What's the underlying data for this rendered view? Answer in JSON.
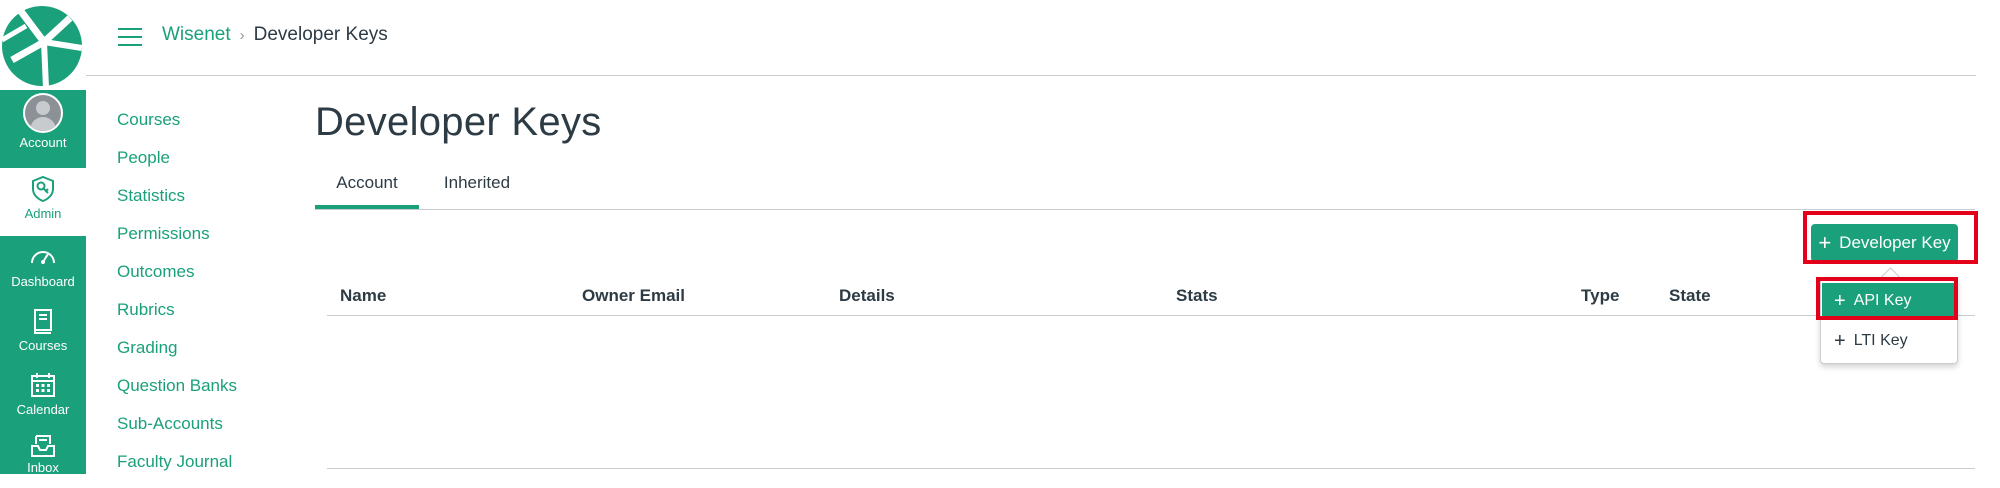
{
  "global_nav": {
    "account_label": "Account",
    "admin_label": "Admin",
    "dashboard_label": "Dashboard",
    "courses_label": "Courses",
    "calendar_label": "Calendar",
    "inbox_label": "Inbox"
  },
  "header": {
    "breadcrumb_root": "Wisenet",
    "breadcrumb_separator": "›",
    "breadcrumb_current": "Developer Keys"
  },
  "course_nav": {
    "items": [
      {
        "label": "Courses"
      },
      {
        "label": "People"
      },
      {
        "label": "Statistics"
      },
      {
        "label": "Permissions"
      },
      {
        "label": "Outcomes"
      },
      {
        "label": "Rubrics"
      },
      {
        "label": "Grading"
      },
      {
        "label": "Question Banks"
      },
      {
        "label": "Sub-Accounts"
      },
      {
        "label": "Faculty Journal"
      }
    ]
  },
  "main": {
    "title": "Developer Keys",
    "tabs": [
      {
        "label": "Account",
        "active": true
      },
      {
        "label": "Inherited",
        "active": false
      }
    ],
    "add_button_label": "Developer Key",
    "dropdown": {
      "api_key_label": "API Key",
      "lti_key_label": "LTI Key"
    },
    "table_headers": [
      "Name",
      "Owner Email",
      "Details",
      "Stats",
      "Type",
      "State"
    ]
  },
  "colors": {
    "brand": "#1aa07a",
    "highlight": "#e2001a",
    "text": "#2d3b45"
  },
  "icons": {
    "logo": "wisenet-logo",
    "admin": "shield-key-icon",
    "dashboard": "speedometer-icon",
    "courses": "book-icon",
    "calendar": "calendar-icon",
    "inbox": "inbox-icon",
    "menu": "hamburger-icon",
    "add": "plus-icon"
  }
}
